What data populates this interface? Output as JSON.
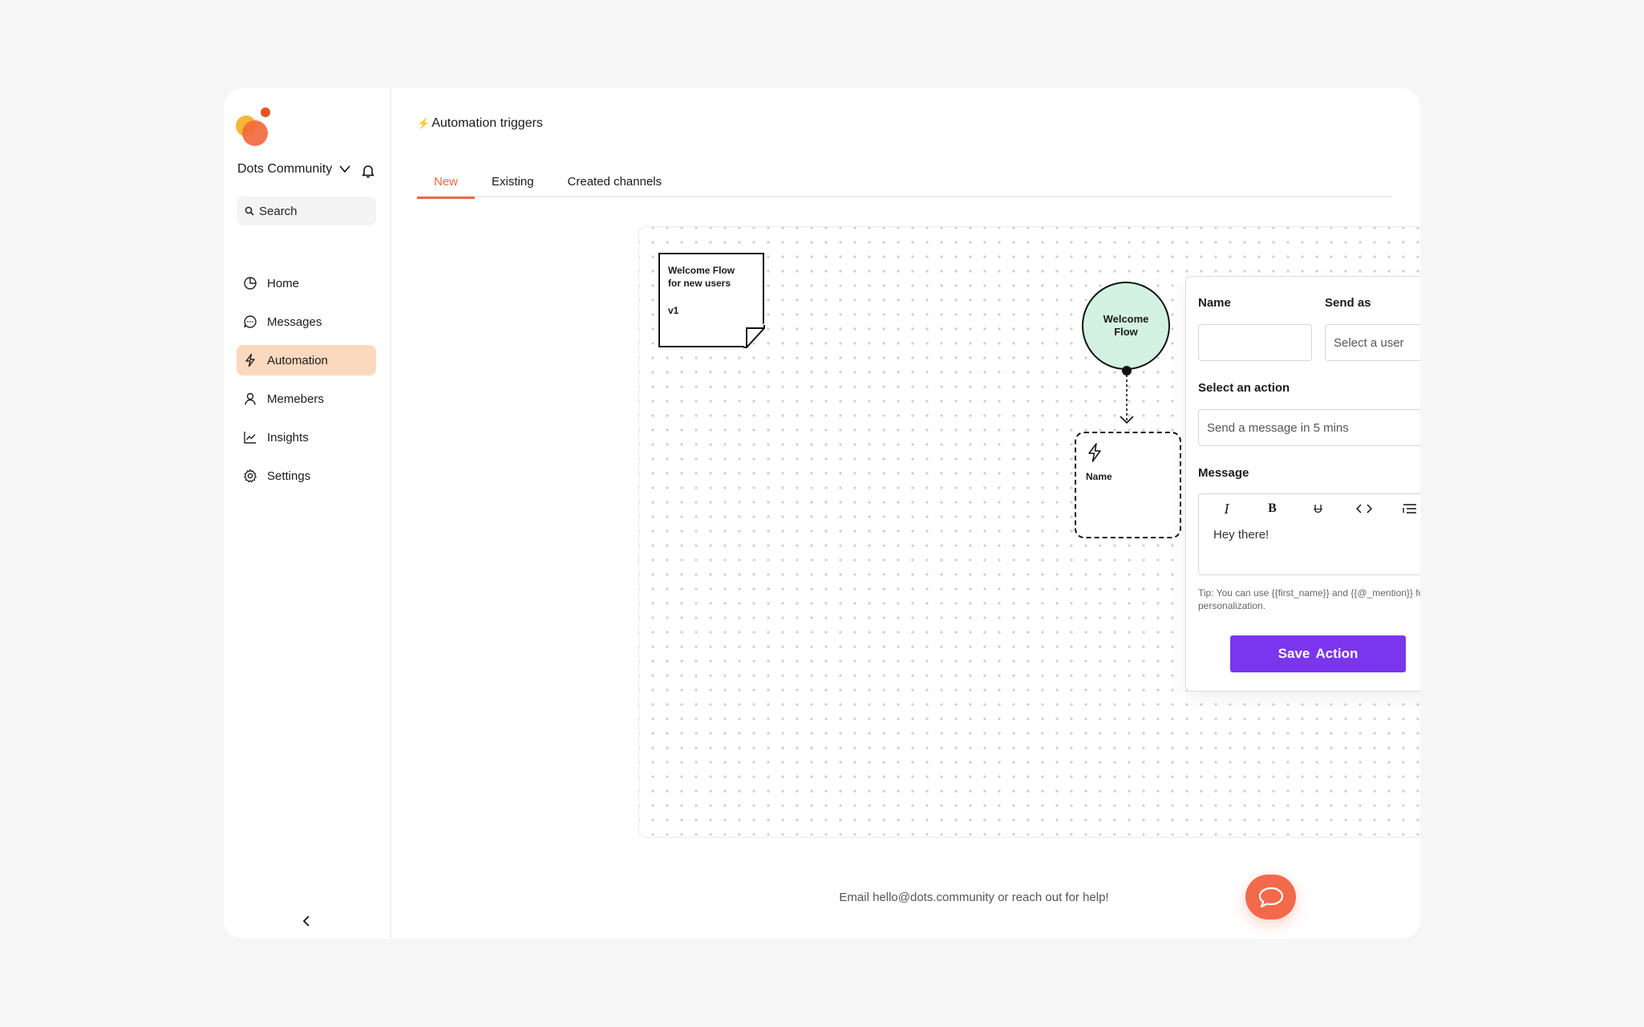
{
  "sidebar": {
    "workspace": "Dots Community",
    "search_placeholder": "Search",
    "items": [
      {
        "label": "Home",
        "icon": "home-chart-icon"
      },
      {
        "label": "Messages",
        "icon": "messages-icon"
      },
      {
        "label": "Automation",
        "icon": "bolt-icon",
        "active": true
      },
      {
        "label": "Memebers",
        "icon": "user-icon"
      },
      {
        "label": "Insights",
        "icon": "chart-line-icon"
      },
      {
        "label": "Settings",
        "icon": "gear-icon"
      }
    ]
  },
  "header": {
    "title": "Automation triggers",
    "tabs": [
      {
        "label": "New",
        "active": true
      },
      {
        "label": "Existing"
      },
      {
        "label": "Created channels"
      }
    ]
  },
  "canvas": {
    "note": {
      "line1": "Welcome Flow",
      "line2": "for new users",
      "version": "v1"
    },
    "flow_node": "Welcome Flow",
    "action_node": "Name"
  },
  "panel": {
    "name_label": "Name",
    "name_value": "",
    "send_as_label": "Send as",
    "send_as_value": "Select a user",
    "action_label": "Select an action",
    "action_value": "Send a message in 5 mins",
    "message_label": "Message",
    "message_value": "Hey there!",
    "tip": "Tip: You can use {{first_name}} and {{@_mention}} for personalization.",
    "save_label": "Save Action"
  },
  "footer": {
    "text": "Email hello@dots.community or reach out for help!"
  },
  "colors": {
    "accent": "#ef6a43",
    "primary_button": "#7b35ee",
    "active_nav": "#fcd9be",
    "flow_node": "#d3f2e2"
  }
}
